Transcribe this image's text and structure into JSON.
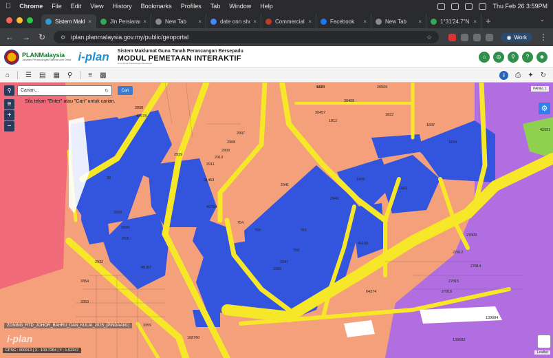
{
  "menubar": {
    "items": [
      "Chrome",
      "File",
      "Edit",
      "View",
      "History",
      "Bookmarks",
      "Profiles",
      "Tab",
      "Window",
      "Help"
    ],
    "clock": "Thu Feb 26  3:59PM"
  },
  "tabs": [
    {
      "label": "Sistem Maklumat",
      "active": true,
      "color": "#2d9bd8"
    },
    {
      "label": "Jln Persiaran",
      "active": false,
      "color": "#34a853"
    },
    {
      "label": "New Tab",
      "active": false,
      "color": "#8a8a8a"
    },
    {
      "label": "date onn shop",
      "active": false,
      "color": "#4285f4"
    },
    {
      "label": "Commercial Pr",
      "active": false,
      "color": "#c0392b"
    },
    {
      "label": "Facebook",
      "active": false,
      "color": "#1877f2"
    },
    {
      "label": "New Tab",
      "active": false,
      "color": "#8a8a8a"
    },
    {
      "label": "1°31'24.7\"N 1",
      "active": false,
      "color": "#34a853"
    }
  ],
  "addressbar": {
    "url": "iplan.planmalaysia.gov.my/public/geoportal",
    "profile": "Work"
  },
  "header": {
    "org": "PLANMalaysia",
    "org_sub": "Jabatan Perancangan Bandar dan Desa",
    "brand": "i-plan",
    "system": "Sistem Maklumat Guna Tanah Perancangan Bersepadu",
    "module": "MODUL PEMETAAN INTERAKTIF",
    "tagline": "Guna Tanah Perancangan Bersepadu"
  },
  "search": {
    "placeholder": "Carian...",
    "button": "Cari",
    "hint": "Sila tekan \"Enter\" atau \"Cari\" untuk carian."
  },
  "map": {
    "panel_label": "PANEL 1",
    "zoning_label": "ZONING_RTD_JOHOR_BAHRU_DAN_KULAI_2025_(PINDAAN1)",
    "watermark": "i-plan",
    "coords": "EPSG : 900913 | X : 103.7284 | Y : 1.52347",
    "attribution": "Leaflet",
    "colors": {
      "residential": "#f4a07a",
      "commercial": "#3355dd",
      "road": "#f6e829",
      "open": "#f06a7a",
      "industrial": "#b06ee0",
      "green": "#8fd14f",
      "infra": "#ffffff"
    },
    "labels": [
      "1810",
      "20506",
      "30457",
      "30458",
      "1822",
      "1837",
      "42931",
      "1812",
      "1834",
      "2941",
      "28",
      "2943",
      "2947",
      "2950",
      "45160",
      "45167",
      "2932",
      "3354",
      "3353",
      "3359",
      "2907",
      "2908",
      "2909",
      "2910",
      "2911",
      "31453",
      "754",
      "755",
      "751",
      "750",
      "1609",
      "1603",
      "27803",
      "27812",
      "27814",
      "27815",
      "27816",
      "139684",
      "139683",
      "64374",
      "168760",
      "44578",
      "2898",
      "2930",
      "2931",
      "2928",
      "2929",
      "45764",
      "5125"
    ]
  },
  "toolbar": {
    "icons": [
      "home-icon",
      "layers-icon",
      "stack-icon",
      "map-icon",
      "zoom-icon",
      "list-icon",
      "grid-icon"
    ]
  }
}
